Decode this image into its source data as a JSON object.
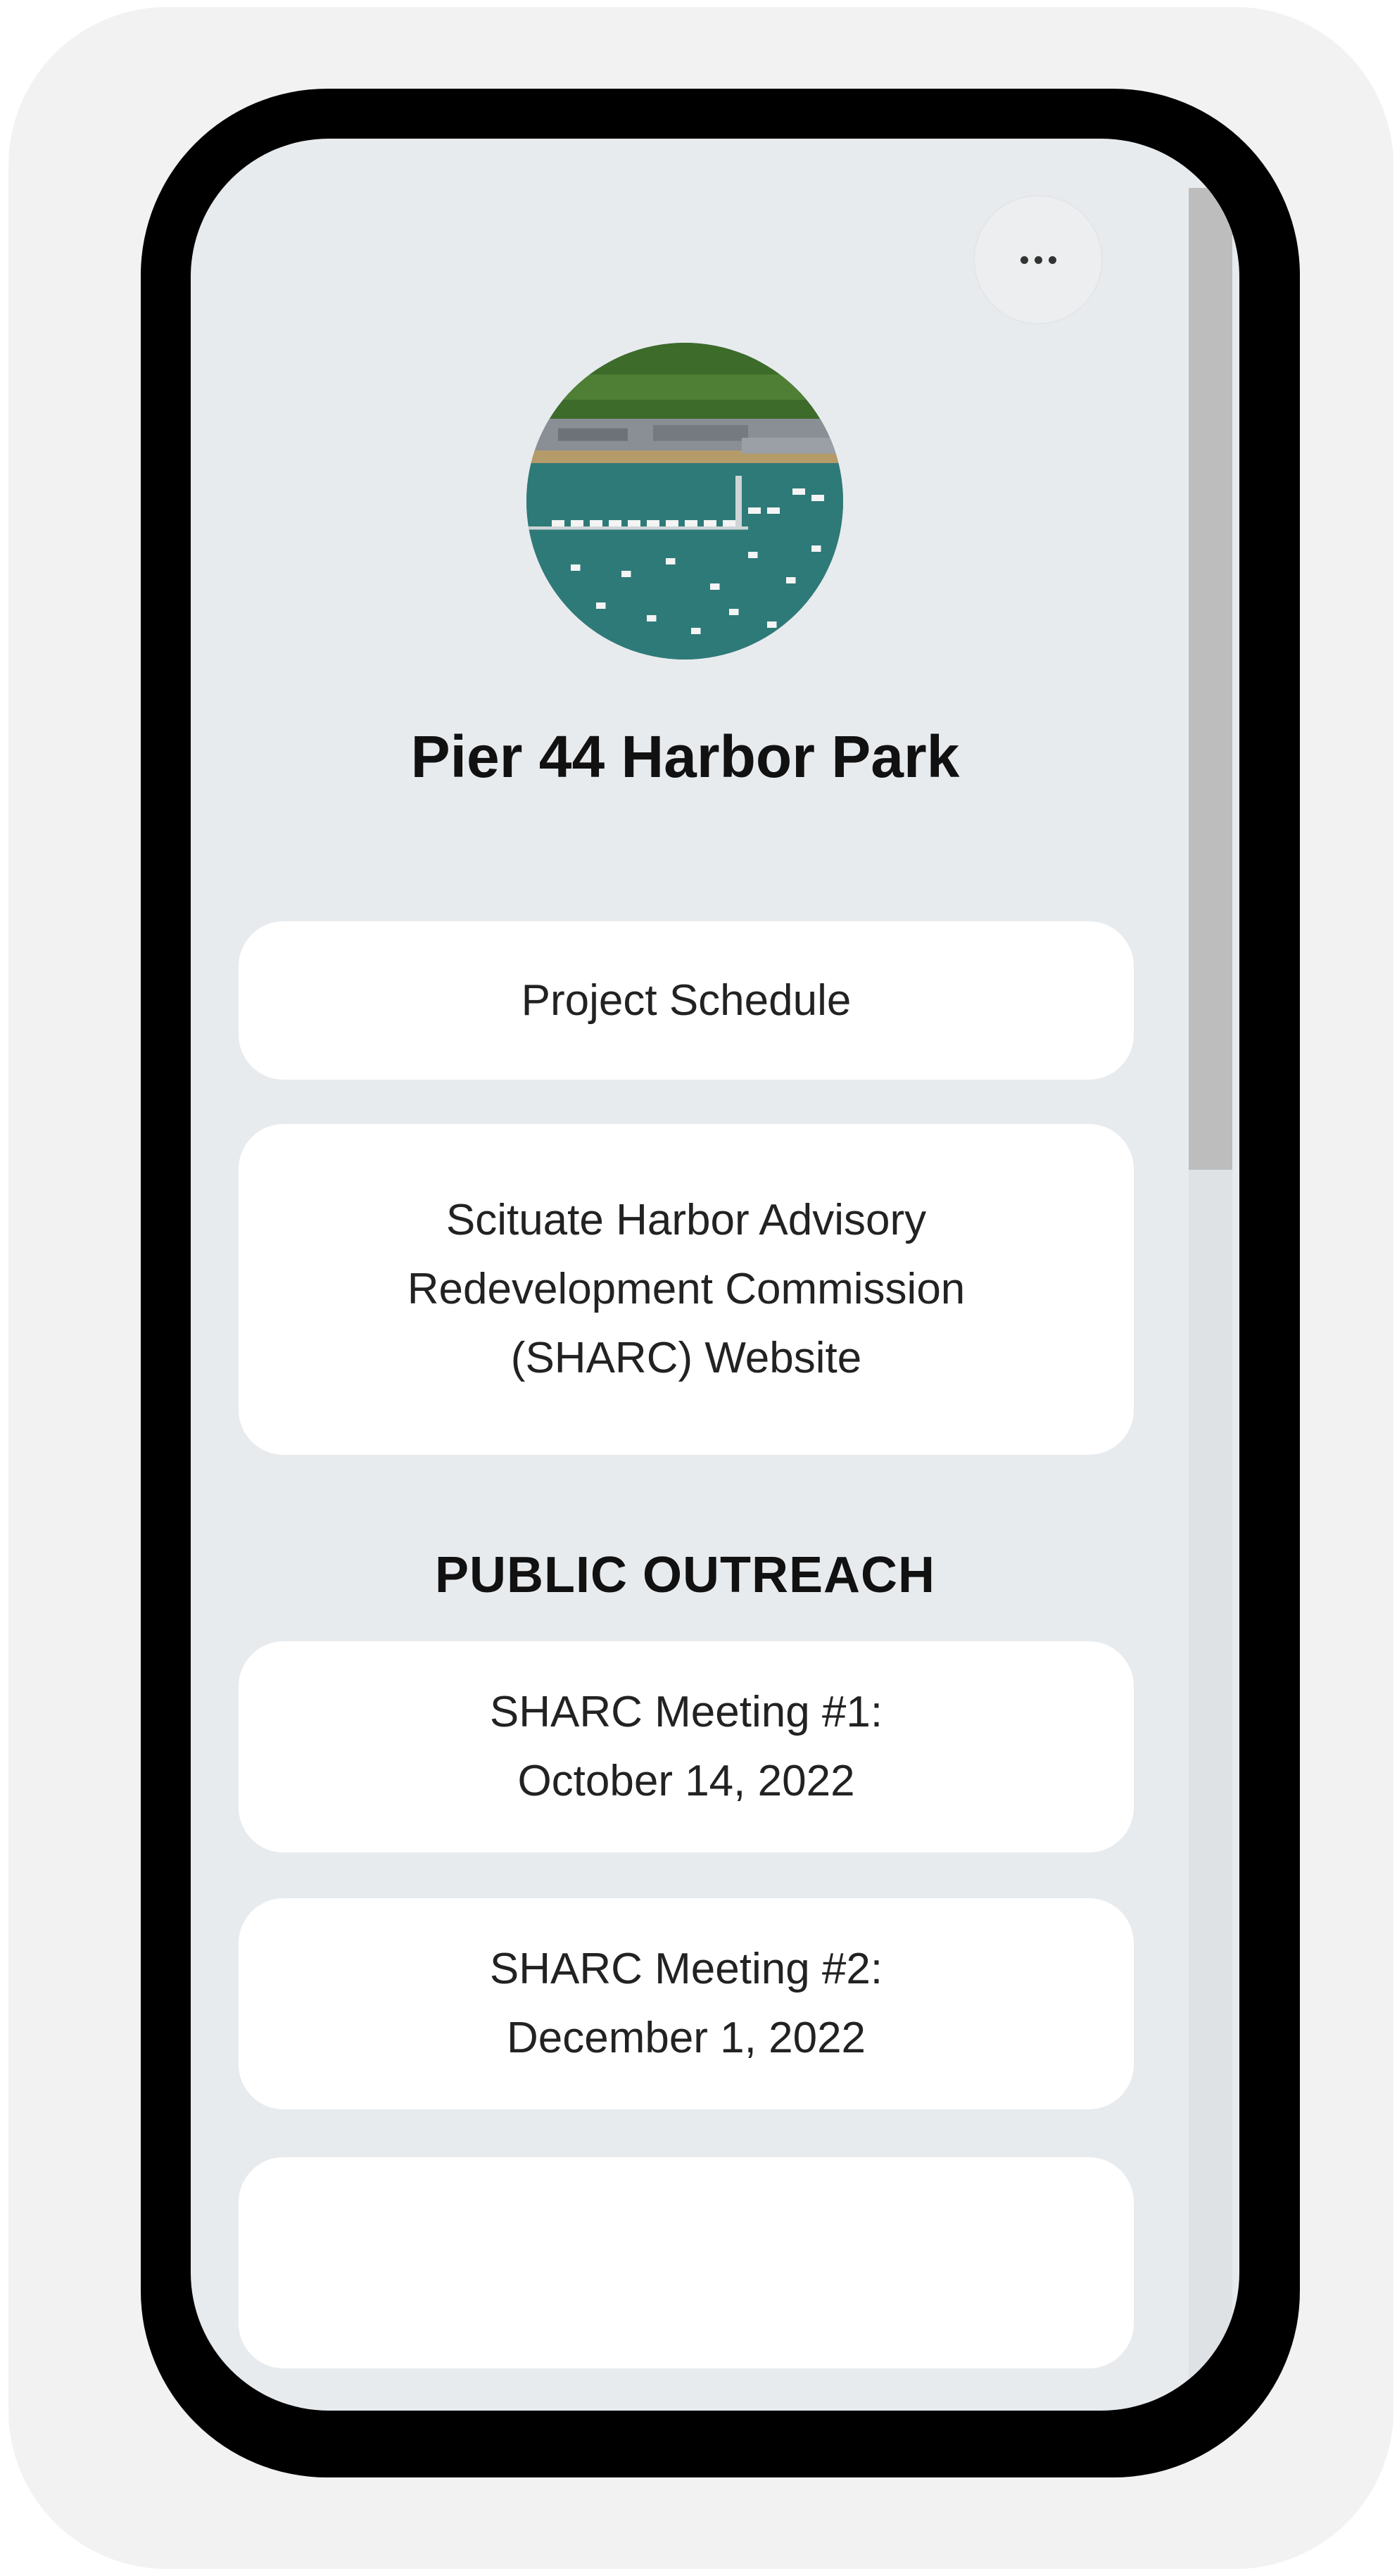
{
  "profile": {
    "title": "Pier 44 Harbor Park",
    "avatar_icon": "harbor-aerial-photo"
  },
  "header": {
    "more_icon": "ellipsis-icon"
  },
  "links": [
    {
      "label": "Project Schedule"
    },
    {
      "label": "Scituate Harbor Advisory Redevelopment Commission (SHARC) Website"
    }
  ],
  "sections": {
    "public_outreach": {
      "heading": "PUBLIC OUTREACH",
      "links": [
        {
          "line1": "SHARC Meeting #1:",
          "line2": "October 14, 2022"
        },
        {
          "line1": "SHARC Meeting #2:",
          "line2": "December 1, 2022"
        }
      ]
    }
  },
  "colors": {
    "background": "#e8ebee",
    "card": "#ffffff",
    "frame": "#000000",
    "text": "#111111"
  }
}
